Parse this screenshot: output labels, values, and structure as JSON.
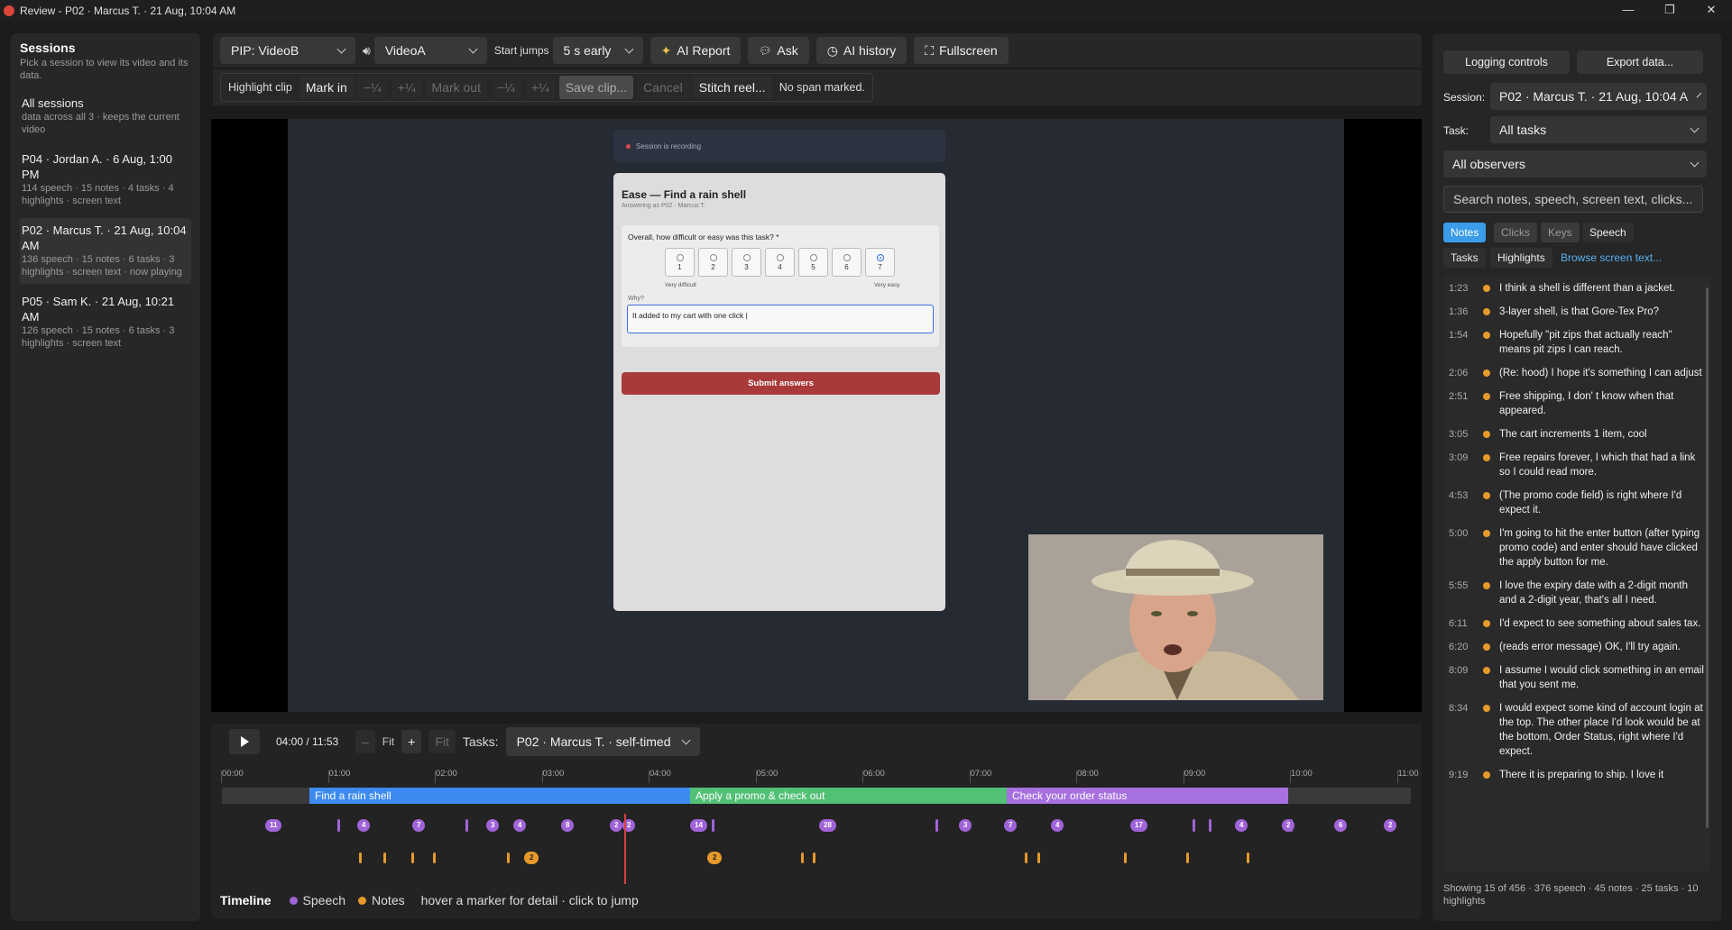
{
  "window": {
    "title": "Review - P02 · Marcus T. · 21 Aug, 10:04 AM",
    "min": "—",
    "max": "❐",
    "close": "✕"
  },
  "sessions": {
    "title": "Sessions",
    "subtitle": "Pick a session to view its video and its data.",
    "items": [
      {
        "title": "All sessions",
        "detail": "data across all 3 · keeps the current video"
      },
      {
        "title": "P04 · Jordan A. · 6 Aug, 1:00 PM",
        "detail": "114 speech · 15 notes · 4 tasks · 4 highlights · screen text"
      },
      {
        "title": "P02 · Marcus T. · 21 Aug, 10:04 AM",
        "detail": "136 speech · 15 notes · 6 tasks · 3 highlights · screen text · now playing"
      },
      {
        "title": "P05 · Sam K. · 21 Aug, 10:21 AM",
        "detail": "126 speech · 15 notes · 6 tasks · 3 highlights · screen text"
      }
    ]
  },
  "toolbar": {
    "pip": "PIP: VideoB",
    "audio": "VideoA",
    "start_jumps_label": "Start jumps",
    "start_jumps": "5 s early",
    "ai_report": "AI Report",
    "ask": "Ask",
    "ai_history": "AI history",
    "fullscreen": "Fullscreen"
  },
  "clip": {
    "label": "Highlight clip",
    "mark_in": "Mark in",
    "minus": "−¼",
    "plus": "+¼",
    "mark_out": "Mark out",
    "minus2": "−¼",
    "plus2": "+¼",
    "save": "Save clip...",
    "cancel": "Cancel",
    "stitch": "Stitch reel...",
    "status": "No span marked."
  },
  "video": {
    "recording": "Session is recording",
    "form_title": "Ease — Find a rain shell",
    "form_sub": "Answering as P02 · Marcus T.",
    "question": "Overall, how difficult or easy was this task? *",
    "options": [
      "1",
      "2",
      "3",
      "4",
      "5",
      "6",
      "7"
    ],
    "selected": "7",
    "low": "Very difficult",
    "high": "Very easy",
    "why": "Why?",
    "answer": "It added to my cart with one click |",
    "submit": "Submit answers"
  },
  "timeline": {
    "time": "04:00 / 11:53",
    "minus": "–",
    "fit": "Fit",
    "plus": "+",
    "fit2": "Fit",
    "tasks_label": "Tasks:",
    "tasks_value": "P02 · Marcus T. · self-timed",
    "ticks": [
      "00:00",
      "01:00",
      "02:00",
      "03:00",
      "04:00",
      "05:00",
      "06:00",
      "07:00",
      "08:00",
      "09:00",
      "10:00",
      "11:00"
    ],
    "task_bars": [
      {
        "label": "Find a rain shell",
        "color": "#3d8bf0"
      },
      {
        "label": "Apply a promo & check out",
        "color": "#52c075"
      },
      {
        "label": "Check your order status",
        "color": "#a670e0"
      }
    ],
    "speech_pills": [
      "11",
      "4",
      "7",
      "3",
      "4",
      "8",
      "2",
      "2",
      "14",
      "28",
      "3",
      "7",
      "4",
      "17",
      "4",
      "2",
      "6",
      "2"
    ],
    "note_pills": [
      "2",
      "2"
    ],
    "legend_title": "Timeline",
    "legend_speech": "Speech",
    "legend_notes": "Notes",
    "legend_hint": "hover a marker for detail · click to jump",
    "speech_color": "#a063d8",
    "notes_color": "#e69a2a"
  },
  "right": {
    "logging": "Logging controls",
    "export": "Export data...",
    "session_label": "Session:",
    "session_value": "P02 · Marcus T. · 21 Aug, 10:04 A",
    "task_label": "Task:",
    "task_value": "All tasks",
    "observers": "All observers",
    "search_placeholder": "Search notes, speech, screen text, clicks...",
    "filters": {
      "notes": "Notes",
      "clicks": "Clicks",
      "keys": "Keys",
      "speech": "Speech",
      "tasks": "Tasks",
      "highlights": "Highlights",
      "browse": "Browse screen text..."
    },
    "notes": [
      {
        "t": "1:23",
        "x": "I think a shell is different than a jacket."
      },
      {
        "t": "1:36",
        "x": "3-layer shell, is that Gore-Tex Pro?"
      },
      {
        "t": "1:54",
        "x": "Hopefully \"pit zips that actually reach\" means pit zips I can reach."
      },
      {
        "t": "2:06",
        "x": "(Re: hood) I hope it's something I can adjust"
      },
      {
        "t": "2:51",
        "x": "Free shipping, I don' t know when that appeared."
      },
      {
        "t": "3:05",
        "x": "The cart increments 1 item, cool"
      },
      {
        "t": "3:09",
        "x": "Free repairs forever, I which that had a link so I could read more."
      },
      {
        "t": "4:53",
        "x": "(The promo code field) is right where I'd expect it."
      },
      {
        "t": "5:00",
        "x": "I'm going to hit the enter button (after typing promo code) and enter should have clicked the apply button for me."
      },
      {
        "t": "5:55",
        "x": "I love the expiry date with a 2-digit month and a 2-digit year, that's all I need."
      },
      {
        "t": "6:11",
        "x": "I'd expect to see something about sales tax."
      },
      {
        "t": "6:20",
        "x": "(reads error message) OK, I'll try again."
      },
      {
        "t": "8:09",
        "x": "I assume I would click something in an email that you sent me."
      },
      {
        "t": "8:34",
        "x": "I would expect some kind of account login at the top. The other place I'd look would be at the bottom, Order Status, right where I'd expect."
      },
      {
        "t": "9:19",
        "x": "There it is preparing to ship. I love it"
      }
    ],
    "status": "Showing 15 of 456 · 376 speech · 45 notes · 25 tasks · 10 highlights"
  }
}
